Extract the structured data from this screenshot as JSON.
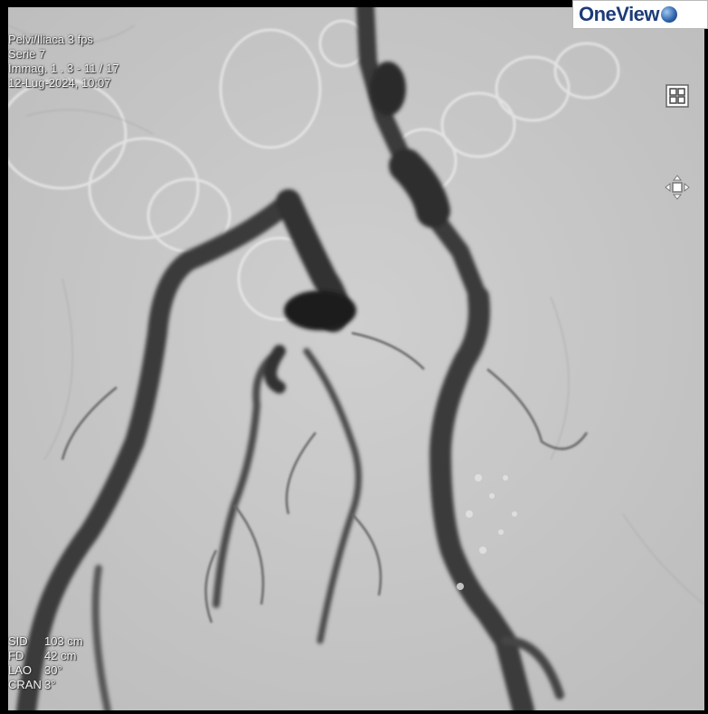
{
  "logo": {
    "text": "OneView"
  },
  "series_info": {
    "protocol": "Pelvi/Iliaca 3 fps",
    "series": "Serie 7",
    "image": "Immag. 1 . 3 - 11 / 17",
    "datetime": "12-Lug-2024, 10:07"
  },
  "geometry_info": [
    {
      "label": "SID",
      "value": "103 cm"
    },
    {
      "label": "FD",
      "value": "42 cm"
    },
    {
      "label": "LAO",
      "value": "30°"
    },
    {
      "label": "CRAN",
      "value": "3°"
    }
  ],
  "toolbar": {
    "layout_icon": "grid-layout-icon",
    "pan_icon": "pan-move-icon"
  },
  "colors": {
    "background": "#c9c9c9",
    "vessel": "#333333",
    "overlay_text": "#f4f4f4",
    "logo_text": "#1d3b78"
  }
}
